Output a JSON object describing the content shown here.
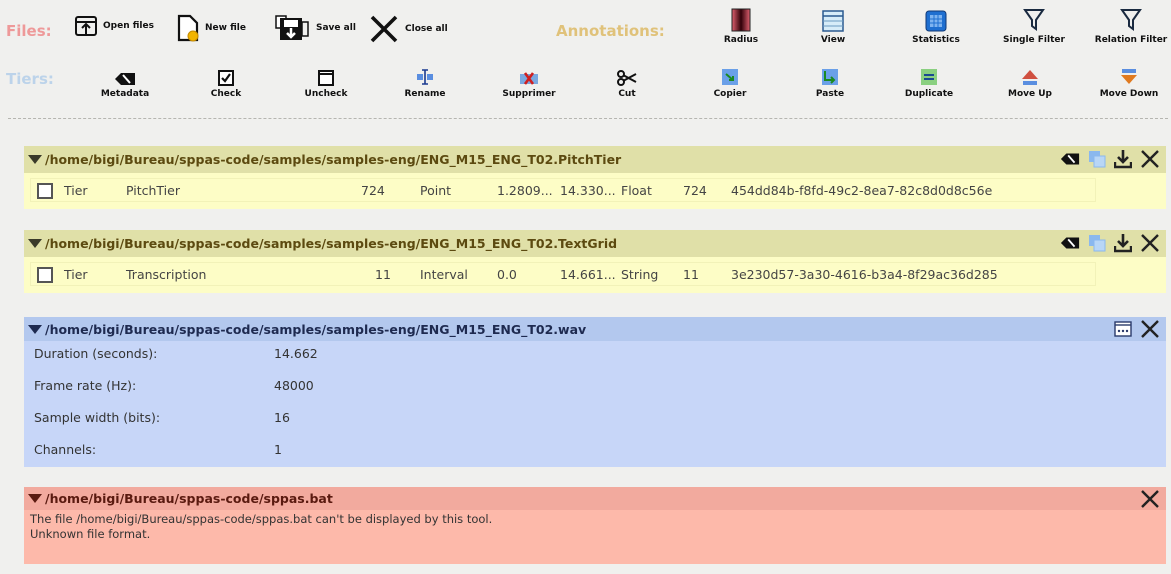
{
  "toolbar": {
    "files_label": "Files:",
    "annotations_label": "Annotations:",
    "tiers_label": "Tiers:",
    "files_buttons": {
      "open": "Open files",
      "new": "New file",
      "save_all": "Save all",
      "close_all": "Close all"
    },
    "annotation_buttons": {
      "radius": "Radius",
      "view": "View",
      "statistics": "Statistics",
      "single_filter": "Single Filter",
      "relation_filter": "Relation Filter"
    },
    "tier_buttons": {
      "metadata": "Metadata",
      "check": "Check",
      "uncheck": "Uncheck",
      "rename": "Rename",
      "supprimer": "Supprimer",
      "cut": "Cut",
      "copier": "Copier",
      "paste": "Paste",
      "duplicate": "Duplicate",
      "move_up": "Move Up",
      "move_down": "Move Down"
    }
  },
  "files": {
    "pitchtier": {
      "path": "/home/bigi/Bureau/sppas-code/samples/samples-eng/ENG_M15_ENG_T02.PitchTier",
      "tier": {
        "kind": "Tier",
        "name": "PitchTier",
        "count": "724",
        "type": "Point",
        "begin": "1.2809...",
        "end": "14.330...",
        "label_type": "Float",
        "count2": "724",
        "id": "454dd84b-f8fd-49c2-8ea7-82c8d0d8c56e"
      }
    },
    "textgrid": {
      "path": "/home/bigi/Bureau/sppas-code/samples/samples-eng/ENG_M15_ENG_T02.TextGrid",
      "tier": {
        "kind": "Tier",
        "name": "Transcription",
        "count": "11",
        "type": "Interval",
        "begin": "0.0",
        "end": "14.661...",
        "label_type": "String",
        "count2": "11",
        "id": "3e230d57-3a30-4616-b3a4-8f29ac36d285"
      }
    },
    "wav": {
      "path": "/home/bigi/Bureau/sppas-code/samples/samples-eng/ENG_M15_ENG_T02.wav",
      "props": {
        "duration_label": "Duration (seconds):",
        "duration": "14.662",
        "framerate_label": "Frame rate (Hz):",
        "framerate": "48000",
        "sampwidth_label": "Sample width (bits):",
        "sampwidth": "16",
        "channels_label": "Channels:",
        "channels": "1"
      }
    },
    "bat": {
      "path": "/home/bigi/Bureau/sppas-code/sppas.bat",
      "message1": "The file /home/bigi/Bureau/sppas-code/sppas.bat can't be displayed by this tool.",
      "message2": "Unknown file format."
    }
  },
  "colors": {
    "files_label": "#ee9999",
    "annotations_label": "#e0c27a",
    "tiers_label": "#bcd3ea",
    "annotated_header": "#e0e0a8",
    "annotated_body": "#fdfdc6",
    "audio_header": "#b3c8ee",
    "audio_body": "#c7d6f8",
    "error_header": "#f2aa9e",
    "error_body": "#fdb9aa"
  }
}
